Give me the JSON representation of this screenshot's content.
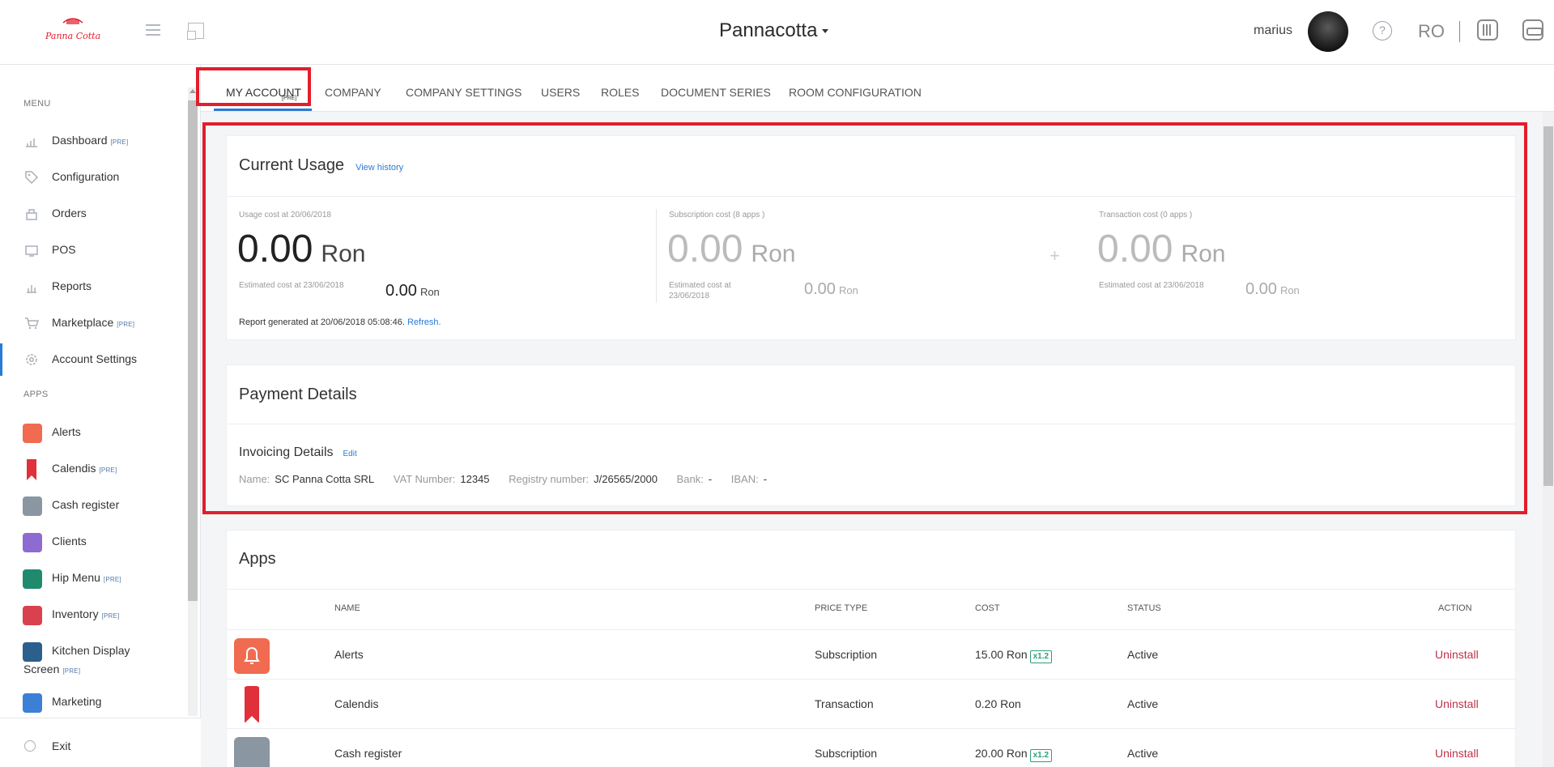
{
  "header": {
    "logo_text": "Panna Cotta",
    "app_title": "Pannacotta",
    "username": "marius",
    "help_symbol": "?",
    "language": "RO",
    "brand_color": "#e21d2c"
  },
  "sidebar": {
    "menu_heading": "MENU",
    "apps_heading": "APPS",
    "pre_badge": "[PRE]",
    "menu_items": [
      {
        "label": "Dashboard",
        "pre": true,
        "icon": "chart-icon"
      },
      {
        "label": "Configuration",
        "pre": false,
        "icon": "tag-icon"
      },
      {
        "label": "Orders",
        "pre": false,
        "icon": "orders-icon"
      },
      {
        "label": "POS",
        "pre": false,
        "icon": "pos-icon"
      },
      {
        "label": "Reports",
        "pre": false,
        "icon": "reports-icon"
      },
      {
        "label": "Marketplace",
        "pre": true,
        "icon": "cart-icon"
      },
      {
        "label": "Account Settings",
        "pre": false,
        "icon": "gear-icon",
        "active": true
      }
    ],
    "app_items": [
      {
        "label": "Alerts",
        "pre": false,
        "color": "#f06b4f"
      },
      {
        "label": "Calendis",
        "pre": true,
        "color": "#e0303a"
      },
      {
        "label": "Cash register",
        "pre": false,
        "color": "#8a96a2"
      },
      {
        "label": "Clients",
        "pre": false,
        "color": "#8e6bd0"
      },
      {
        "label": "Hip Menu",
        "pre": true,
        "color": "#1f8a6e"
      },
      {
        "label": "Inventory",
        "pre": true,
        "color": "#d9414e"
      },
      {
        "label": "Kitchen Display",
        "label_line2": "Screen",
        "pre": true,
        "color": "#2b5f8c"
      },
      {
        "label": "Marketing",
        "pre": false,
        "color": "#3c7fd6"
      }
    ],
    "exit_label": "Exit"
  },
  "tabs": [
    {
      "label": "MY ACCOUNT",
      "active": true,
      "pre": "[PRE]"
    },
    {
      "label": "COMPANY"
    },
    {
      "label": "COMPANY SETTINGS"
    },
    {
      "label": "USERS"
    },
    {
      "label": "ROLES"
    },
    {
      "label": "DOCUMENT SERIES"
    },
    {
      "label": "ROOM CONFIGURATION"
    }
  ],
  "usage": {
    "title": "Current Usage",
    "history_link": "View history",
    "usage_cost": {
      "label": "Usage cost at 20/06/2018",
      "value": "0.00",
      "unit": "Ron",
      "estimated_label": "Estimated cost at 23/06/2018",
      "estimated_value": "0.00",
      "estimated_unit": "Ron"
    },
    "subscription_cost": {
      "label": "Subscription cost (8 apps )",
      "value": "0.00",
      "unit": "Ron",
      "estimated_label_line1": "Estimated cost at",
      "estimated_label_line2": "23/06/2018",
      "estimated_value": "0.00",
      "estimated_unit": "Ron"
    },
    "plus_sign": "+",
    "transaction_cost": {
      "label": "Transaction cost (0 apps )",
      "value": "0.00",
      "unit": "Ron",
      "estimated_label": "Estimated cost at 23/06/2018",
      "estimated_value": "0.00",
      "estimated_unit": "Ron"
    },
    "report_text": "Report generated at 20/06/2018 05:08:46.",
    "refresh_link": "Refresh."
  },
  "payment": {
    "title": "Payment Details",
    "invoicing_title": "Invoicing Details",
    "edit_link": "Edit",
    "fields": [
      {
        "key": "Name:",
        "value": "SC Panna Cotta SRL"
      },
      {
        "key": "VAT Number:",
        "value": "12345"
      },
      {
        "key": "Registry number:",
        "value": "J/26565/2000"
      },
      {
        "key": "Bank:",
        "value": "-"
      },
      {
        "key": "IBAN:",
        "value": "-"
      }
    ]
  },
  "apps": {
    "title": "Apps",
    "columns": [
      "NAME",
      "PRICE TYPE",
      "COST",
      "STATUS",
      "ACTION"
    ],
    "rows": [
      {
        "name": "Alerts",
        "price_type": "Subscription",
        "cost": "15.00 Ron",
        "multiplier": "x1.2",
        "status": "Active",
        "action": "Uninstall",
        "color": "#f06b4f"
      },
      {
        "name": "Calendis",
        "price_type": "Transaction",
        "cost": "0.20 Ron",
        "multiplier": "",
        "status": "Active",
        "action": "Uninstall",
        "color": "#e0303a"
      },
      {
        "name": "Cash register",
        "price_type": "Subscription",
        "cost": "20.00 Ron",
        "multiplier": "x1.2",
        "status": "Active",
        "action": "Uninstall",
        "color": "#8a96a2"
      }
    ]
  }
}
